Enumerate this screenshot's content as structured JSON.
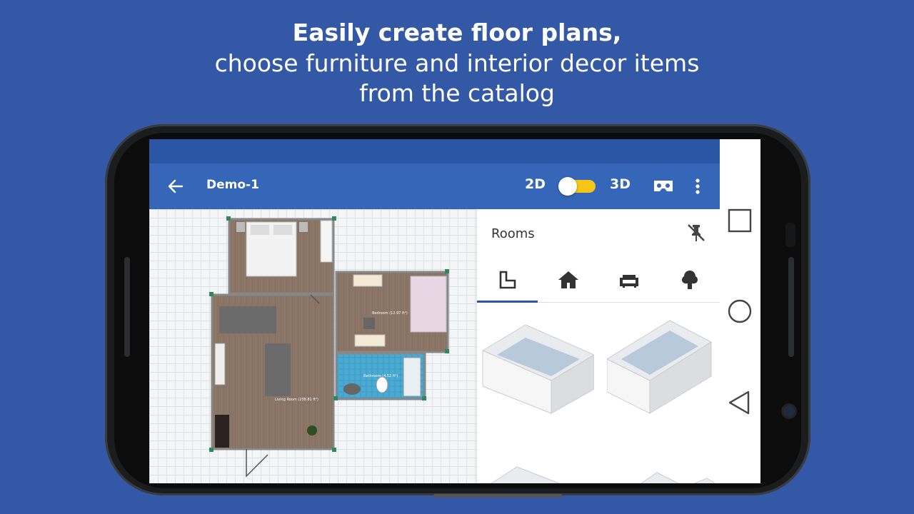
{
  "promo": {
    "line1": "Easily create floor plans,",
    "line2": "choose furniture and interior decor items",
    "line3": "from the catalog"
  },
  "appbar": {
    "title": "Demo-1",
    "mode_2d": "2D",
    "mode_3d": "3D",
    "toggle_state": "3D"
  },
  "panel": {
    "title": "Rooms",
    "tabs": [
      "rooms-tab",
      "house-tab",
      "furniture-tab",
      "plants-tab"
    ],
    "active_tab": 0
  },
  "floorplan": {
    "rooms": [
      {
        "label": "Bedroom (12.97 ft²)"
      },
      {
        "label": "Bathroom (4.52 ft²)"
      },
      {
        "label": "Living Room (238.81 ft²)"
      }
    ]
  },
  "colors": {
    "background": "#3358a6",
    "appbar": "#3566b8",
    "toggle": "#f5c518",
    "tab_indicator": "#2b56a6"
  }
}
